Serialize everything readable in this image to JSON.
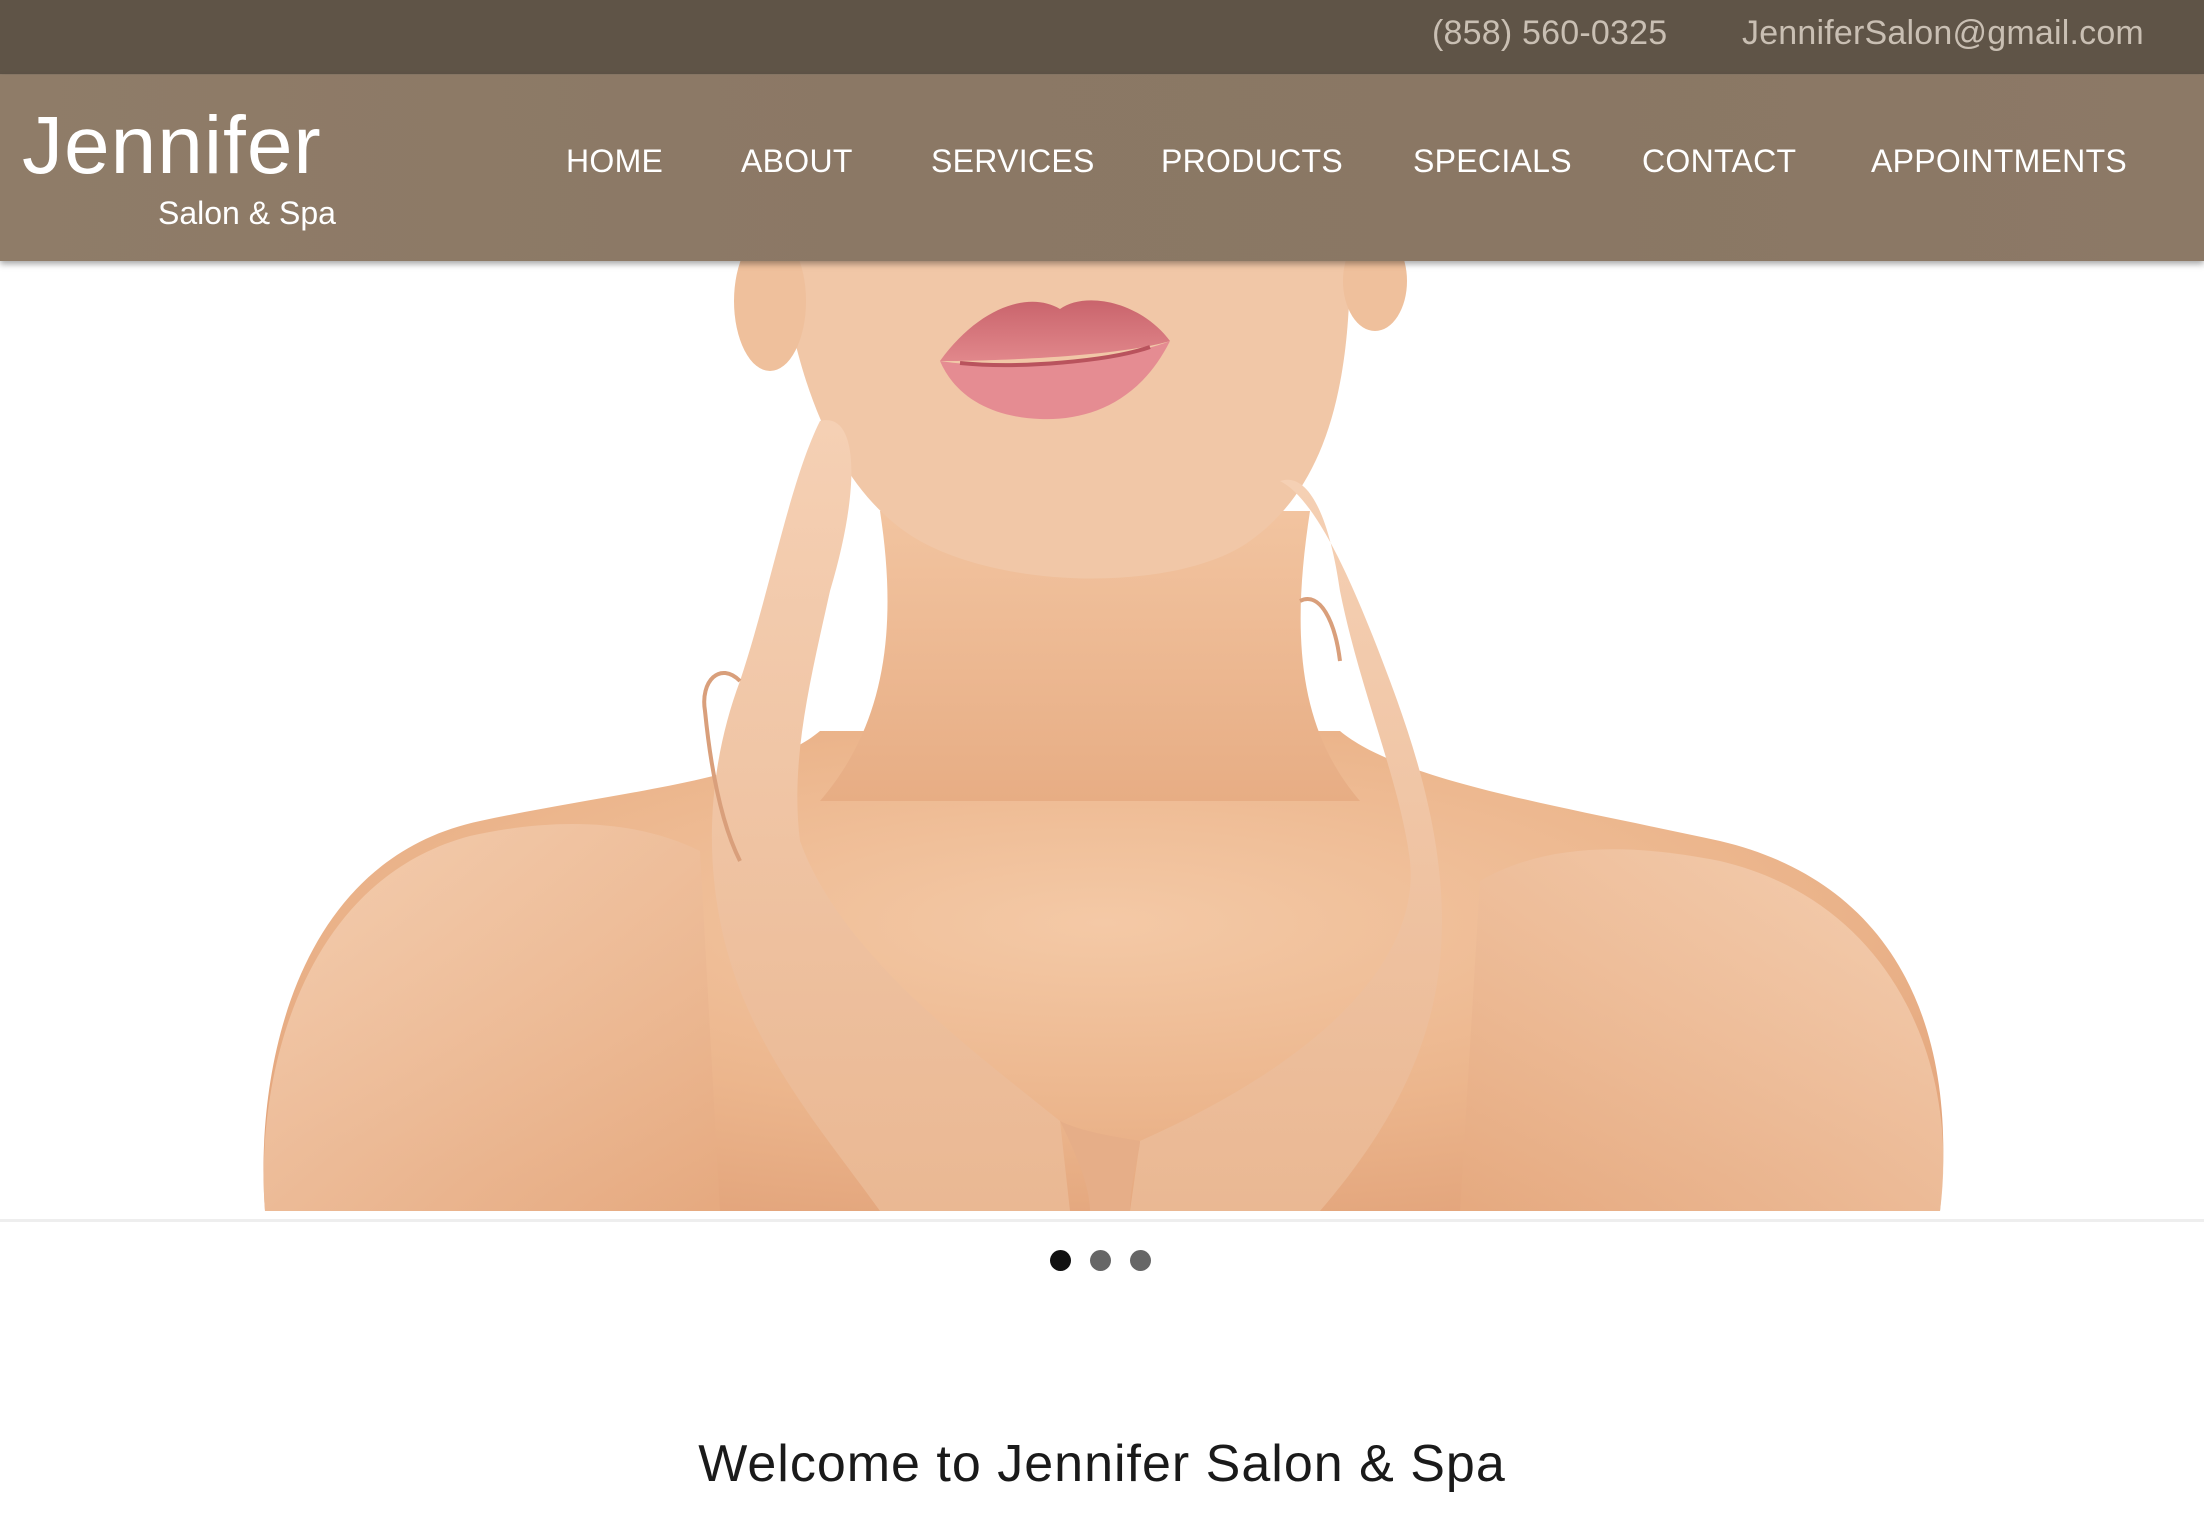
{
  "topbar": {
    "phone": "(858) 560-0325",
    "email": "JenniferSalon@gmail.com"
  },
  "header": {
    "logo_main": "Jennifer",
    "logo_sub": "Salon & Spa"
  },
  "nav": {
    "items": [
      {
        "label": "HOME"
      },
      {
        "label": "ABOUT"
      },
      {
        "label": "SERVICES"
      },
      {
        "label": "PRODUCTS"
      },
      {
        "label": "SPECIALS"
      },
      {
        "label": "CONTACT"
      },
      {
        "label": "APPOINTMENTS"
      }
    ]
  },
  "hero": {
    "image": "woman-neck-hands-skincare-photo"
  },
  "carousel": {
    "slide_count": 3,
    "active_index": 0
  },
  "main": {
    "welcome_heading": "Welcome to Jennifer Salon & Spa"
  },
  "colors": {
    "topbar_bg": "#5f5447",
    "header_bg": "#8b7865",
    "nav_text": "#ffffff",
    "topbar_text": "#c9bfb3",
    "dot_active": "#111111",
    "dot_inactive": "#666666"
  }
}
